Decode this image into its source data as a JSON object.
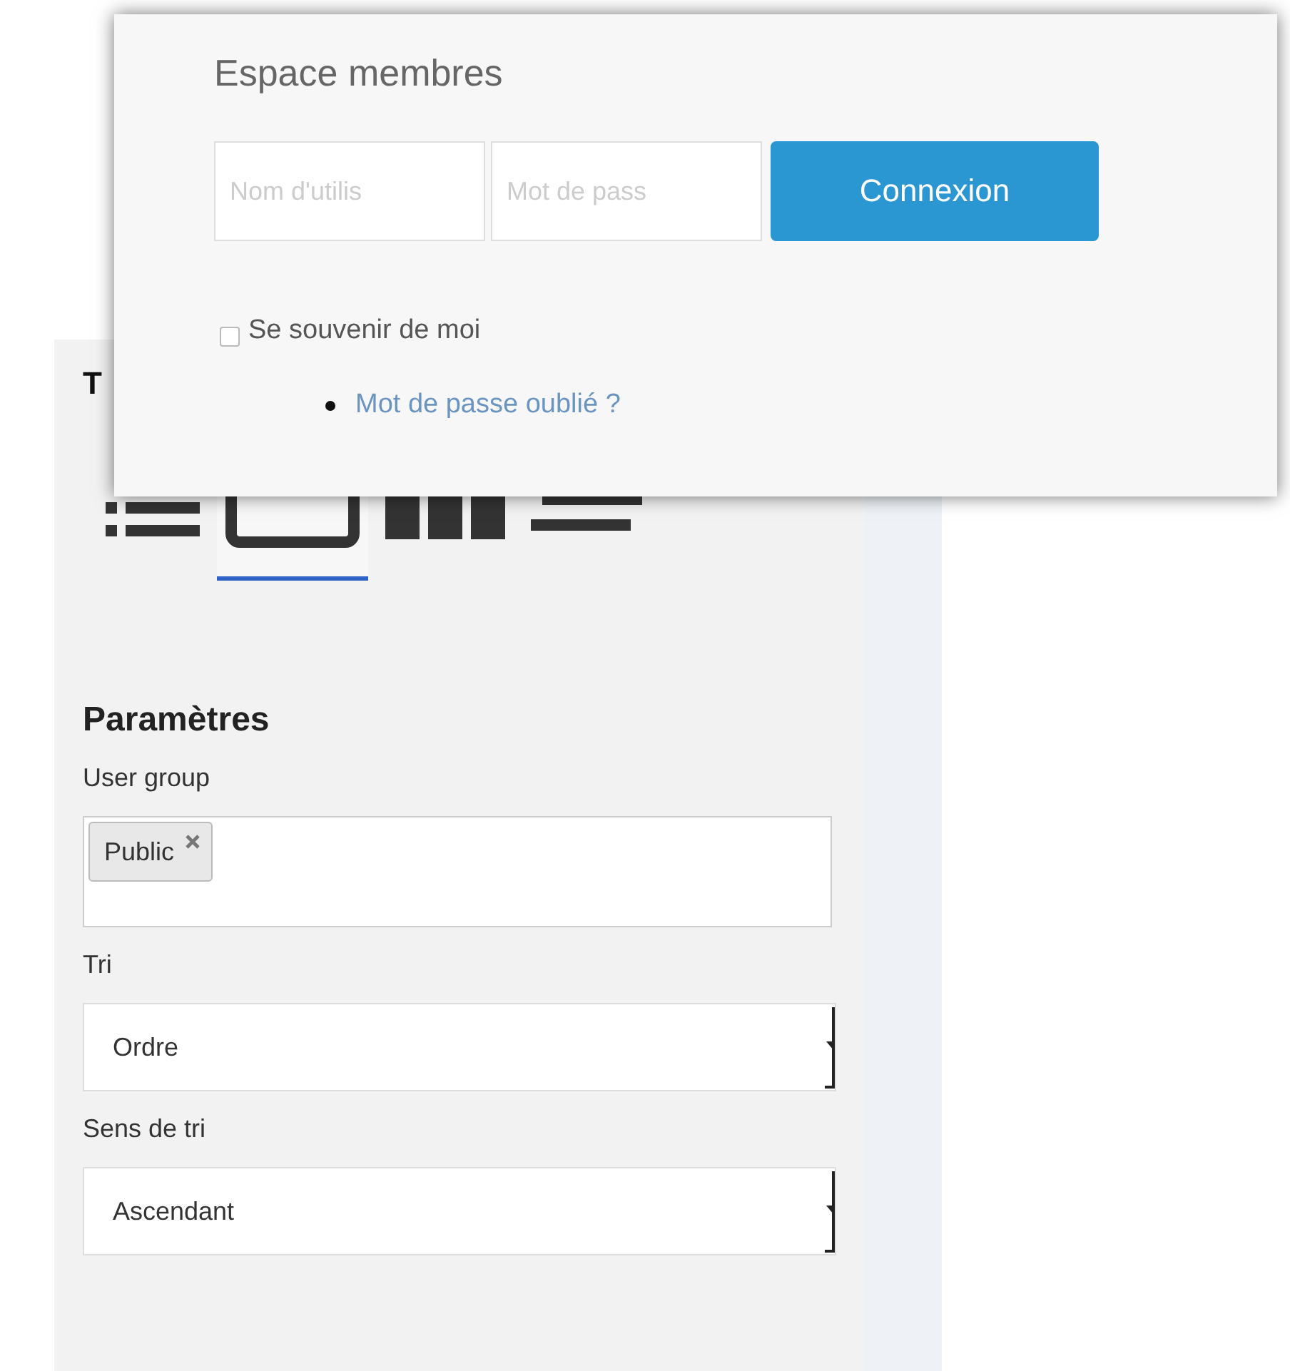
{
  "panel": {
    "heading": "T",
    "layouts": [
      {
        "kind": "list",
        "selected": false
      },
      {
        "kind": "single",
        "selected": true
      },
      {
        "kind": "columns",
        "selected": false
      },
      {
        "kind": "lines",
        "selected": false
      }
    ],
    "section_title": "Paramètres",
    "fields": [
      {
        "kind": "tags",
        "label": "User group",
        "tags": [
          "Public"
        ]
      },
      {
        "kind": "select",
        "label": "Tri",
        "value": "Ordre"
      },
      {
        "kind": "select",
        "label": "Sens de tri",
        "value": "Ascendant"
      }
    ]
  },
  "login_popup": {
    "title": "Espace membres",
    "username": {
      "placeholder": "Nom d'utilis"
    },
    "password": {
      "placeholder": "Mot de pass"
    },
    "button": "Connexion",
    "remember": {
      "label": "Se souvenir de moi",
      "checked": false
    },
    "links": [
      "Mot de passe oublié ?"
    ]
  }
}
